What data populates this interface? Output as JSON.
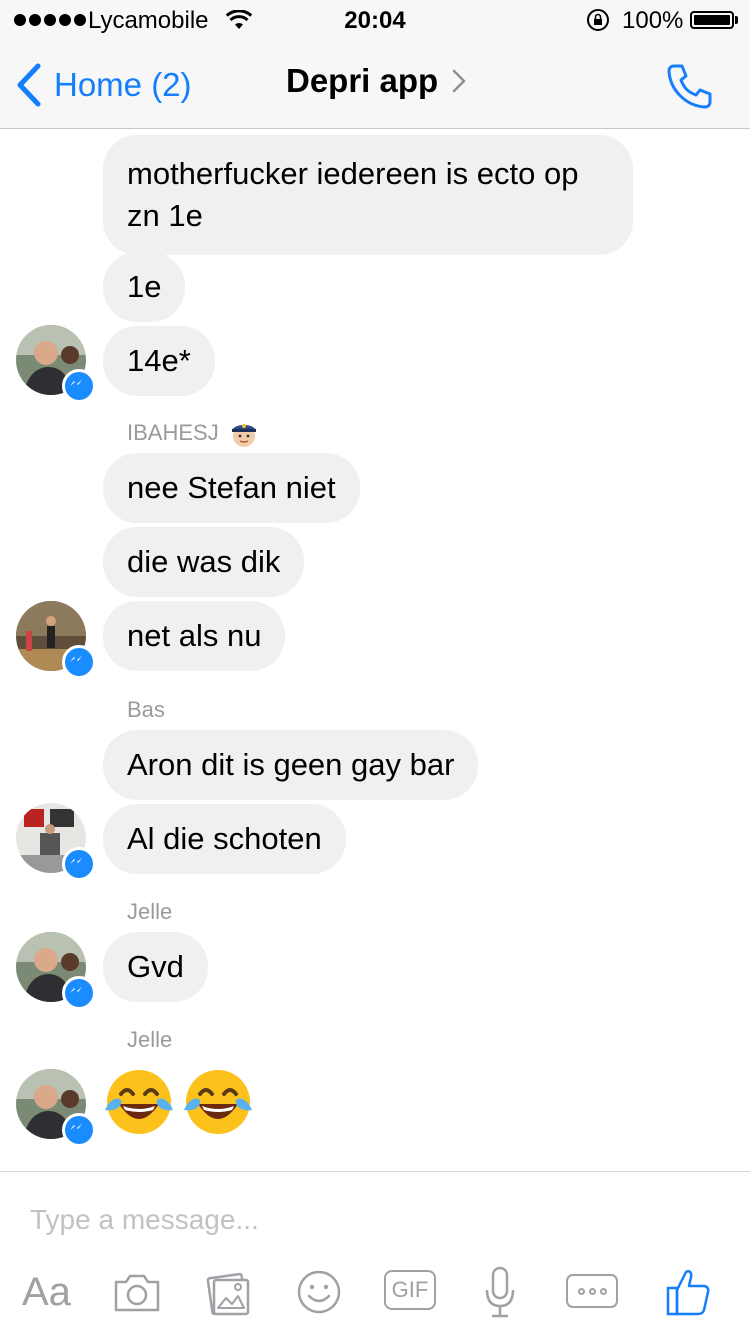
{
  "status_bar": {
    "carrier": "Lycamobile",
    "time": "20:04",
    "battery": "100%"
  },
  "nav": {
    "back_label": "Home (2)",
    "title": "Depri app"
  },
  "messages": [
    {
      "type": "text",
      "text": "motherfucker iedereen is ecto op zn 1e"
    },
    {
      "type": "text",
      "text": "1e"
    },
    {
      "type": "text",
      "text": "14e*"
    },
    {
      "type": "sender",
      "text": "IBAHESJ"
    },
    {
      "type": "text",
      "text": "nee Stefan niet"
    },
    {
      "type": "text",
      "text": "die was dik"
    },
    {
      "type": "text",
      "text": "net als nu"
    },
    {
      "type": "sender",
      "text": "Bas"
    },
    {
      "type": "text",
      "text": "Aron dit is geen gay bar"
    },
    {
      "type": "text",
      "text": "Al die schoten"
    },
    {
      "type": "sender",
      "text": "Jelle"
    },
    {
      "type": "text",
      "text": "Gvd"
    },
    {
      "type": "sender",
      "text": "Jelle"
    },
    {
      "type": "emoji",
      "icons": [
        "face-with-tears-of-joy-icon",
        "face-with-tears-of-joy-icon"
      ]
    }
  ],
  "composer": {
    "placeholder": "Type a message...",
    "tools": [
      "Aa",
      "camera-icon",
      "photo-icon",
      "smiley-icon",
      "GIF",
      "microphone-icon",
      "more-icon",
      "thumbs-up-icon"
    ]
  },
  "colors": {
    "accent": "#147efb",
    "bubble": "#f1f0f0",
    "messenger_badge": "#1a8cff"
  }
}
